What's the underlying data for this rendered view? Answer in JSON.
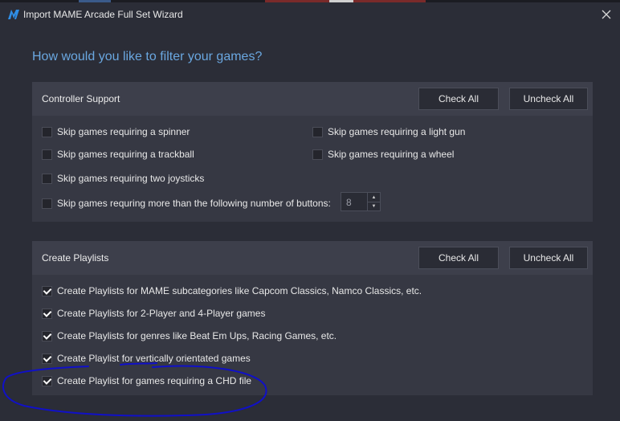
{
  "window": {
    "title": "Import MAME Arcade Full Set Wizard",
    "icon": "launchbox-m-icon",
    "close_icon": "close-icon"
  },
  "heading": "How would you like to filter your games?",
  "colors": {
    "background": "#2b2d37",
    "panel": "#363843",
    "panel_header": "#3d3f4b",
    "heading": "#6aa7e0",
    "annotation": "#1010c8"
  },
  "controller_support": {
    "title": "Controller Support",
    "check_all": "Check All",
    "uncheck_all": "Uncheck All",
    "options": [
      {
        "label": "Skip games requiring a spinner",
        "checked": false
      },
      {
        "label": "Skip games requiring a light gun",
        "checked": false
      },
      {
        "label": "Skip games requiring a trackball",
        "checked": false
      },
      {
        "label": "Skip games requiring a wheel",
        "checked": false
      },
      {
        "label": "Skip games requiring two joysticks",
        "checked": false
      },
      {
        "label": "Skip games requring more than the following number of buttons:",
        "checked": false
      }
    ],
    "buttons_value": "8"
  },
  "create_playlists": {
    "title": "Create Playlists",
    "check_all": "Check All",
    "uncheck_all": "Uncheck All",
    "options": [
      {
        "label": "Create Playlists for MAME subcategories like Capcom Classics, Namco Classics, etc.",
        "checked": true
      },
      {
        "label": "Create Playlists for 2-Player and 4-Player games",
        "checked": true
      },
      {
        "label": "Create Playlists for genres like Beat Em Ups, Racing Games, etc.",
        "checked": true
      },
      {
        "label": "Create Playlist for vertically orientated games",
        "checked": true
      },
      {
        "label": "Create Playlist for games requiring a CHD file",
        "checked": true
      }
    ]
  }
}
